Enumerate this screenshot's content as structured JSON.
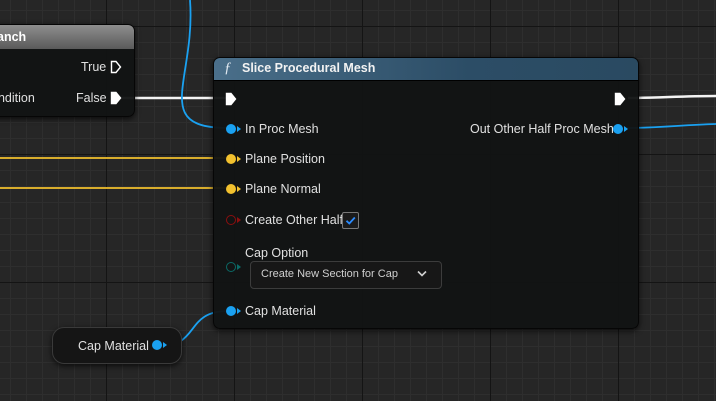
{
  "branch_node": {
    "title": "anch",
    "pins": {
      "true_label": "True",
      "false_label": "False",
      "condition_label": "ondition"
    }
  },
  "slice_node": {
    "title": "Slice Procedural Mesh",
    "function_icon": "ƒ",
    "inputs": {
      "in_proc_mesh": "In Proc Mesh",
      "plane_position": "Plane Position",
      "plane_normal": "Plane Normal",
      "create_other_half": "Create Other Half",
      "cap_option": "Cap Option",
      "cap_material": "Cap Material"
    },
    "outputs": {
      "out_other_half": "Out Other Half Proc Mesh"
    },
    "create_other_half_checked": true,
    "cap_option_value": "Create New Section for Cap"
  },
  "cap_material_node": {
    "label": "Cap Material"
  },
  "colors": {
    "object_pin": "#1aa1f1",
    "vector_pin": "#f2c12e",
    "bool_pin": "#8c0f0f",
    "enum_pin": "#0b5a58",
    "exec_pin": "#ffffff",
    "header": "#2c4d66"
  }
}
